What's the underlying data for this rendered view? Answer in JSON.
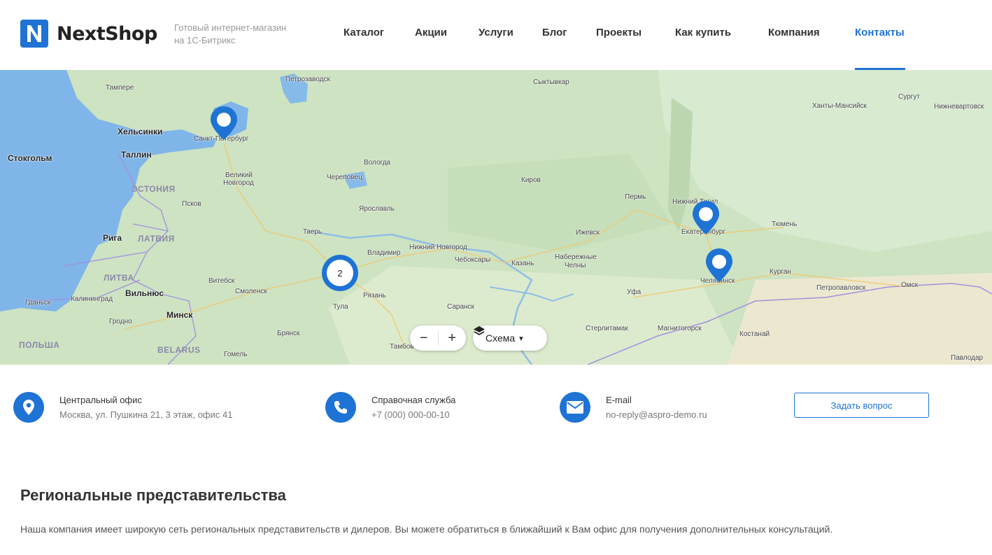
{
  "brand": {
    "logo_letter": "N",
    "name": "NextShop",
    "tagline_line1": "Готовый интернет-магазин",
    "tagline_line2": "на 1С-Битрикс",
    "accent_color": "#1e73d4"
  },
  "nav": {
    "items": [
      {
        "label": "Каталог"
      },
      {
        "label": "Акции"
      },
      {
        "label": "Услуги"
      },
      {
        "label": "Блог"
      },
      {
        "label": "Проекты"
      },
      {
        "label": "Как купить"
      },
      {
        "label": "Компания"
      },
      {
        "label": "Контакты",
        "active": true
      }
    ]
  },
  "map": {
    "cities": [
      {
        "name": "Тампере"
      },
      {
        "name": "Петрозаводск"
      },
      {
        "name": "Сыктывкар"
      },
      {
        "name": "Сургут"
      },
      {
        "name": "Ханты-Мансийск"
      },
      {
        "name": "Нижневартовск"
      },
      {
        "name": "Хельсинки"
      },
      {
        "name": "Санкт-Петербург"
      },
      {
        "name": "Таллин"
      },
      {
        "name": "Стокгольм"
      },
      {
        "name": "Вологда"
      },
      {
        "name": "Великий"
      },
      {
        "name": "Новгород"
      },
      {
        "name": "Череповец"
      },
      {
        "name": "Киров"
      },
      {
        "name": "Псков"
      },
      {
        "name": "Ярославль"
      },
      {
        "name": "Пермь"
      },
      {
        "name": "Нижний Тагил"
      },
      {
        "name": "Екатеринбург"
      },
      {
        "name": "Тюмень"
      },
      {
        "name": "Тверь"
      },
      {
        "name": "Рига"
      },
      {
        "name": "Ижевск"
      },
      {
        "name": "Владимир"
      },
      {
        "name": "Нижний Новгород"
      },
      {
        "name": "Набережные"
      },
      {
        "name": "Челны"
      },
      {
        "name": "Чебоксары"
      },
      {
        "name": "Казань"
      },
      {
        "name": "Курган"
      },
      {
        "name": "Челябинск"
      },
      {
        "name": "Витебск"
      },
      {
        "name": "Смоленск"
      },
      {
        "name": "Вильнюс"
      },
      {
        "name": "Калининград"
      },
      {
        "name": "Гданьск"
      },
      {
        "name": "Рязань"
      },
      {
        "name": "Тула"
      },
      {
        "name": "Уфа"
      },
      {
        "name": "Петропавловск"
      },
      {
        "name": "Омск"
      },
      {
        "name": "Саранск"
      },
      {
        "name": "Минск"
      },
      {
        "name": "Гродно"
      },
      {
        "name": "Стерлитамак"
      },
      {
        "name": "Магнитогорск"
      },
      {
        "name": "Брянск"
      },
      {
        "name": "Костанай"
      },
      {
        "name": "Тамбов"
      },
      {
        "name": "Гомель"
      },
      {
        "name": "Павлодар"
      }
    ],
    "countries": [
      "ЭСТОНИЯ",
      "ЛАТВИЯ",
      "ЛИТВА",
      "ПОЛЬША",
      "BELARUS"
    ],
    "cluster_count": "2",
    "zoom_out_label": "−",
    "zoom_in_label": "+",
    "layer_label": "Схема",
    "layer_caret": "▾"
  },
  "contacts": [
    {
      "icon": "location-pin-icon",
      "title": "Центральный офис",
      "value": "Москва, ул. Пушкина 21, 3 этаж, офис 41"
    },
    {
      "icon": "phone-icon",
      "title": "Справочная служба",
      "value": "+7 (000) 000-00-10"
    },
    {
      "icon": "envelope-icon",
      "title": "E-mail",
      "value": "no-reply@aspro-demo.ru"
    }
  ],
  "ask_button": "Задать вопрос",
  "regional": {
    "title": "Региональные представительства",
    "text": "Наша компания имеет широкую сеть региональных представительств и дилеров. Вы можете обратиться в ближайший к Вам офис для получения дополнительных консультаций."
  }
}
